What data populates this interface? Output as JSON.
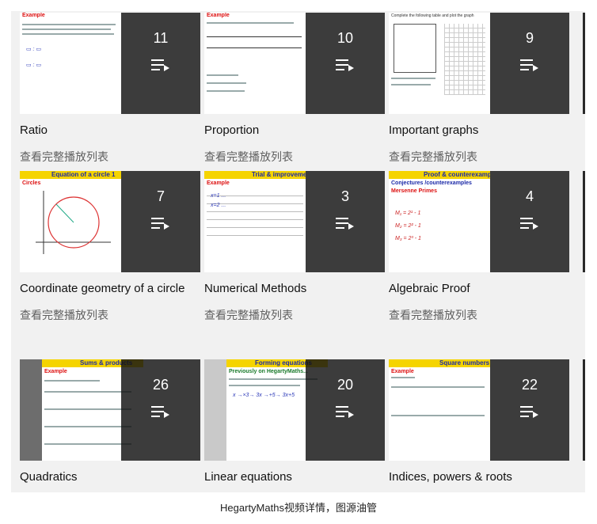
{
  "subtitle_label": "查看完整播放列表",
  "caption": "HegartyMaths视频详情，图源油管",
  "playlists": [
    {
      "title": "Ratio",
      "count": "11",
      "slide_header": "Example",
      "slide_style": "white"
    },
    {
      "title": "Proportion",
      "count": "10",
      "slide_header": "Example",
      "slide_style": "white"
    },
    {
      "title": "Important graphs",
      "count": "9",
      "slide_header": "Complete the following table and plot the graph",
      "slide_style": "white"
    },
    {
      "title": "Coordinate geometry of a circle",
      "count": "7",
      "slide_header": "Equation of a circle 1",
      "slide_style": "yellow"
    },
    {
      "title": "Numerical Methods",
      "count": "3",
      "slide_header": "Trial & improvement",
      "slide_style": "yellow"
    },
    {
      "title": "Algebraic Proof",
      "count": "4",
      "slide_header": "Proof & counterexamples",
      "slide_style": "yellow"
    },
    {
      "title": "Quadratics",
      "count": "26",
      "slide_header": "Sums & products",
      "slide_style": "yellow"
    },
    {
      "title": "Linear equations",
      "count": "20",
      "slide_header": "Forming equations",
      "slide_style": "yellow"
    },
    {
      "title": "Indices, powers & roots",
      "count": "22",
      "slide_header": "Square numbers",
      "slide_style": "yellow"
    }
  ]
}
